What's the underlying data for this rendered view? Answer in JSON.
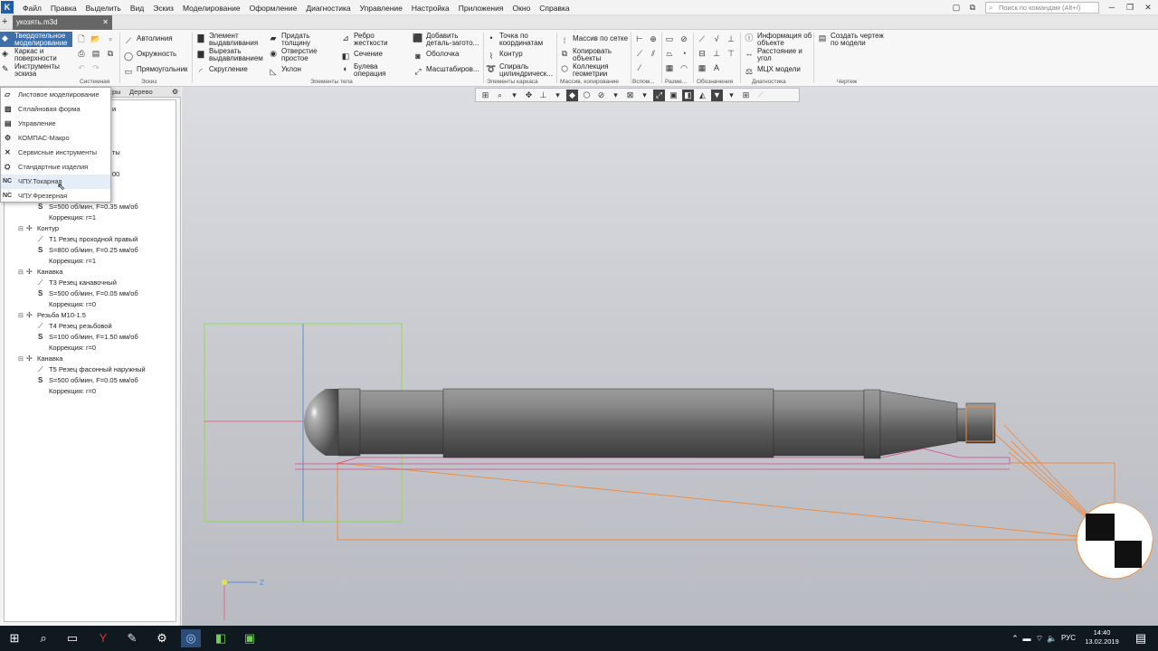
{
  "menu": [
    "Файл",
    "Правка",
    "Выделить",
    "Вид",
    "Эскиз",
    "Моделирование",
    "Оформление",
    "Диагностика",
    "Управление",
    "Настройка",
    "Приложения",
    "Окно",
    "Справка"
  ],
  "search_placeholder": "Поиск по командам (Alt+/)",
  "document_tab": "укозять.m3d",
  "modes": {
    "solid": "Твердотельное моделирование",
    "surface": "Каркас и поверхности",
    "sketch": "Инструменты эскиза"
  },
  "ribbon": {
    "sketch": [
      "Автолиния",
      "Окружность",
      "Прямоугольник"
    ],
    "body1": [
      "Элемент выдавливания",
      "Вырезать выдавливанием",
      "Скругление"
    ],
    "body2": [
      "Придать толщину",
      "Отверстие простое",
      "Уклон"
    ],
    "body3": [
      "Ребро жесткости",
      "Сечение",
      "Булева операция"
    ],
    "body4": [
      "Добавить деталь-загото...",
      "Оболочка",
      "Масштабиров..."
    ],
    "frame": [
      "Точка по координатам",
      "Контур",
      "Спираль цилиндрическ..."
    ],
    "array": [
      "Массив по сетке",
      "Копировать объекты",
      "Коллекция геометрии"
    ],
    "diag": [
      "Информация об объекте",
      "Расстояние и угол",
      "МЦХ модели"
    ],
    "drawing": [
      "Создать чертеж по модели"
    ],
    "groups": [
      "Системная",
      "Эскиз",
      "Элементы тела",
      "Элементы каркаса",
      "Массив, копирование",
      "Вспом...",
      "Разме...",
      "Обозначения",
      "Диагностика",
      "Чертеж"
    ]
  },
  "panel_tabs": [
    "ры",
    "Дерево"
  ],
  "dropdown": [
    {
      "icon": "sheet-icon",
      "label": "Листовое моделирование"
    },
    {
      "icon": "spline-icon",
      "label": "Сплайновая форма"
    },
    {
      "icon": "manage-icon",
      "label": "Управление"
    },
    {
      "icon": "gear-icon",
      "label": "КОМПАС-Макро"
    },
    {
      "icon": "wrench-icon",
      "label": "Сервисные инструменты"
    },
    {
      "icon": "bolt-icon",
      "label": "Стандартные изделия"
    },
    {
      "icon": "nc-icon",
      "label": "ЧПУ.Токарная"
    },
    {
      "icon": "nc-icon",
      "label": "ЧПУ.Фрезерная"
    }
  ],
  "tree_partial": [
    "и",
    "ты",
    "00"
  ],
  "tree": [
    {
      "label": "й правый",
      "indent": 2
    },
    {
      "label": "S=500 об/мин, F=0.35 мм/об",
      "indent": 3
    },
    {
      "label": "Коррекция: r=1",
      "indent": 3
    },
    {
      "label": "Контур",
      "indent": 1
    },
    {
      "label": "T1  Резец проходной правый",
      "indent": 2
    },
    {
      "label": "S=800 об/мин, F=0.25 мм/об",
      "indent": 3
    },
    {
      "label": "Коррекция: r=1",
      "indent": 3
    },
    {
      "label": "Канавка",
      "indent": 1
    },
    {
      "label": "T3  Резец канавочный",
      "indent": 2
    },
    {
      "label": "S=500 об/мин, F=0.05 мм/об",
      "indent": 3
    },
    {
      "label": "Коррекция: r=0",
      "indent": 3
    },
    {
      "label": "Резьба М10-1.5",
      "indent": 1
    },
    {
      "label": "T4  Резец резьбовой",
      "indent": 2
    },
    {
      "label": "S=100 об/мин, F=1.50 мм/об",
      "indent": 3
    },
    {
      "label": "Коррекция: r=0",
      "indent": 3
    },
    {
      "label": "Канавка",
      "indent": 1
    },
    {
      "label": "T5  Резец фасонный наружный",
      "indent": 2
    },
    {
      "label": "S=500 об/мин, F=0.05 мм/об",
      "indent": 3
    },
    {
      "label": "Коррекция: r=0",
      "indent": 3
    }
  ],
  "axis_label": "Z",
  "taskbar": {
    "lang": "РУС",
    "time": "14:40",
    "date": "13.02.2019"
  },
  "colors": {
    "accent": "#3d6fa8",
    "toolpath": "#f08a3c",
    "selection": "#8fdc5a"
  }
}
